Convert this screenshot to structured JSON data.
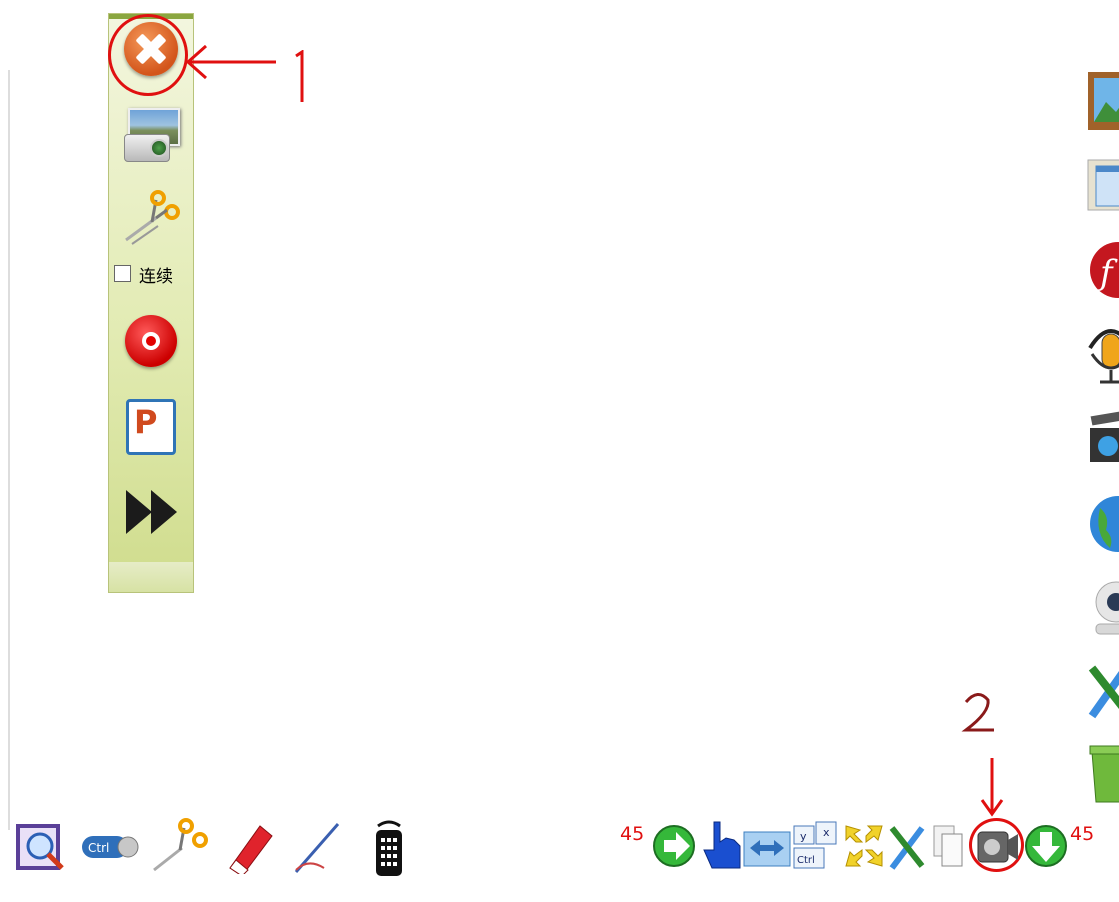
{
  "capture_panel": {
    "close_label": "Close",
    "screenshot_label": "Screenshot",
    "cut_label": "Cut",
    "continuous_checkbox": {
      "label": "连续",
      "checked": false
    },
    "record_label": "Record",
    "ppt_label": "P",
    "forward_label": "Forward"
  },
  "annotations": {
    "one": "1",
    "two": "2"
  },
  "right_dock": {
    "items": [
      "picture-frame-icon",
      "window-slides-icon",
      "flash-icon",
      "microphone-icon",
      "video-clapper-icon",
      "globe-icon",
      "webcam-icon",
      "tools-icon",
      "recycle-bin-icon"
    ]
  },
  "bottom_left_toolbar": {
    "items": [
      "magnifier-book-icon",
      "ctrl-key-icon",
      "scissors-icon",
      "eraser-icon",
      "pen-icon",
      "remote-control-icon"
    ],
    "ctrl_text": "Ctrl"
  },
  "bottom_right_toolbar": {
    "page_left": "45",
    "page_right": "45",
    "items": [
      "next-arrow-icon",
      "hand-pointer-icon",
      "swap-arrows-icon",
      "keyboard-shortcut-icon",
      "expand-icon",
      "tools-icon",
      "copy-pages-icon",
      "camera-video-icon",
      "down-arrow-icon"
    ],
    "keys": {
      "y": "y",
      "x": "x",
      "ctrl": "Ctrl"
    }
  },
  "colors": {
    "annotation": "#e01010",
    "panel": "#e2ebb3"
  }
}
